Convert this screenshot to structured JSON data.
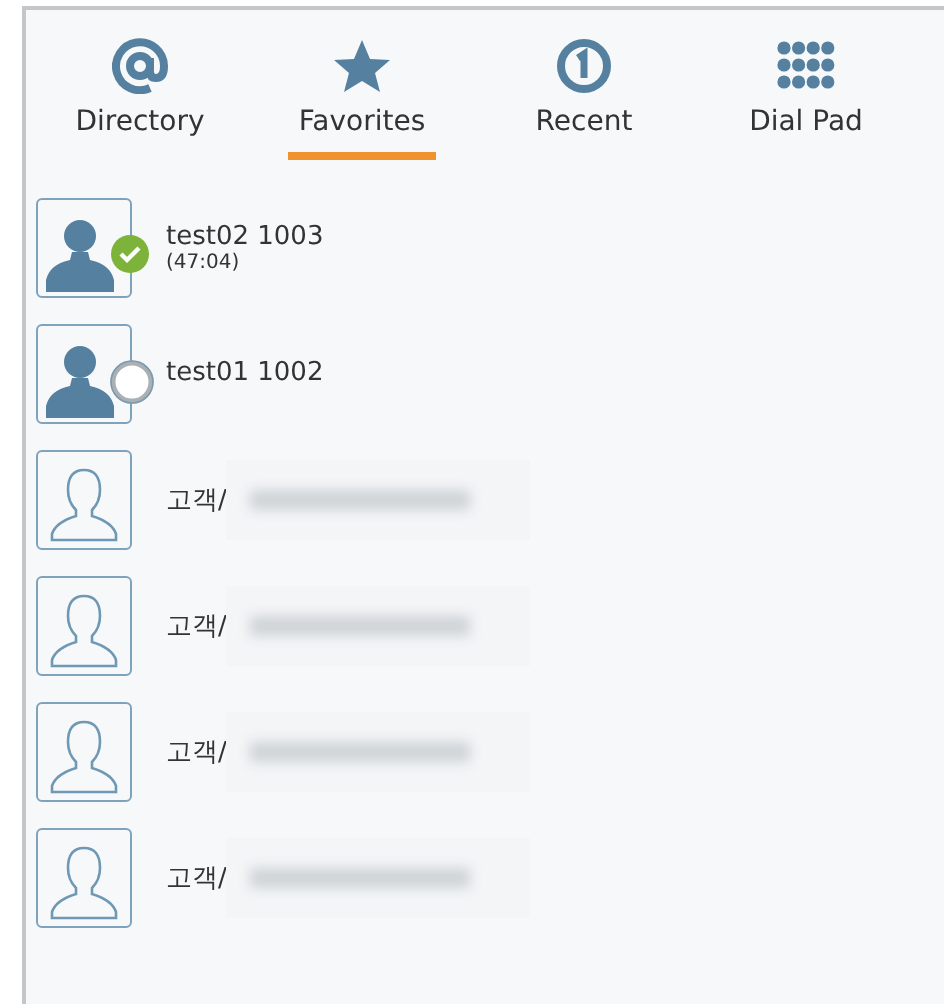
{
  "tabs": [
    {
      "label": "Directory",
      "kind": "at",
      "selected": false
    },
    {
      "label": "Favorites",
      "kind": "star",
      "selected": true
    },
    {
      "label": "Recent",
      "kind": "recent",
      "selected": false
    },
    {
      "label": "Dial Pad",
      "kind": "dialpad",
      "selected": false
    }
  ],
  "contacts": [
    {
      "kind": "user",
      "name": "test02 1003",
      "duration": "(47:04)",
      "online": true
    },
    {
      "kind": "user",
      "name": "test01 1002",
      "online": false
    },
    {
      "kind": "customer",
      "name": "고객/",
      "redacted": true
    },
    {
      "kind": "customer",
      "name": "고객/",
      "redacted": true
    },
    {
      "kind": "customer",
      "name": "고객/",
      "redacted": true
    },
    {
      "kind": "customer",
      "name": "고객/",
      "redacted": true
    }
  ]
}
